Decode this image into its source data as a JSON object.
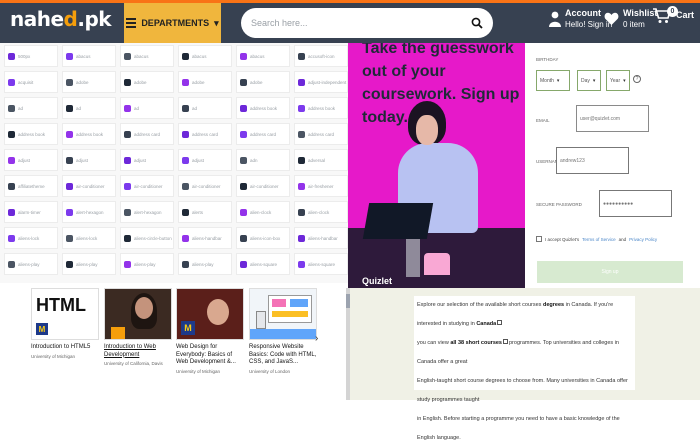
{
  "header": {
    "logo_main": "nahe",
    "logo_accent": "d",
    "logo_suffix": ".pk",
    "departments_label": "DEPARTMENTS",
    "search_placeholder": "Search here...",
    "account_title": "Account",
    "account_sub": "Hello! Sign in",
    "wishlist_title": "Wishlist",
    "wishlist_sub": "0 item",
    "cart_title": "Cart",
    "cart_count": "0"
  },
  "icon_grid": {
    "rows": [
      [
        "500px",
        "abacus",
        "abacus",
        "abacus",
        "abacus",
        "accusoft-icon"
      ],
      [
        "acquisit",
        "adobe",
        "adobe",
        "adobe",
        "adobe",
        "adjust-independent"
      ],
      [
        "ad",
        "ad",
        "ad",
        "ad",
        "address book",
        "address book"
      ],
      [
        "address book",
        "address book",
        "address card",
        "address card",
        "address card",
        "address card"
      ],
      [
        "adjust",
        "adjust",
        "adjust",
        "adjust",
        "adn",
        "adversal"
      ],
      [
        "affiliatetheme",
        "air-conditioner",
        "air-conditioner",
        "air-conditioner",
        "air-conditioner",
        "air-freshener"
      ],
      [
        "alarm-timer",
        "alert-hexagon",
        "alert-hexagon",
        "alerts",
        "alien-clock",
        "alien-clock"
      ],
      [
        "aliens-lock",
        "aliens-lock",
        "aliens-circle-button",
        "aliens-handbar",
        "aliens-icon-box",
        "aliens-handbar"
      ],
      [
        "aliens-play",
        "aliens-play",
        "aliens-play",
        "aliens-play",
        "aliens-square",
        "aliens-square"
      ]
    ],
    "glyph_colors": [
      "#6d28d9",
      "#7c3aed",
      "#4b5563",
      "#1f2937",
      "#9333ea",
      "#374151"
    ]
  },
  "promo": {
    "headline": "Take the guesswork out of your coursework. Sign up today.",
    "brand": "Quizlet",
    "bg_color": "#e619c9"
  },
  "signup": {
    "birthday_label": "BIRTHDAY",
    "month": "Month",
    "day": "Day",
    "year": "Year",
    "help": "?",
    "email_label": "EMAIL",
    "email_placeholder": "user@quizlet.com",
    "username_label": "USERNAME",
    "username_placeholder": "andrew123",
    "password_label": "SECURE PASSWORD",
    "password_placeholder": "●●●●●●●●●●",
    "agree_prefix": "I accept Quizlet's",
    "terms": "Terms of Service",
    "and": "and",
    "privacy": "Privacy Policy",
    "button": "Sign up",
    "accent_color": "#86a86b"
  },
  "courses": [
    {
      "title": "Introduction to HTML5",
      "provider": "University of Michigan",
      "thumb_text": "HTML",
      "badge": "M"
    },
    {
      "title": "Introduction to Web Development",
      "provider": "University of California, Davis"
    },
    {
      "title": "Web Design for Everybody: Basics of Web Development &...",
      "provider": "University of Michigan",
      "badge": "M"
    },
    {
      "title": "Responsive Website Basics: Code with HTML, CSS, and JavaS...",
      "provider": "University of London"
    }
  ],
  "description": {
    "line1_a": "Explore our selection of the available short courses",
    "line1_b": "degrees",
    "line1_c": "in Canada. If you're interested in studying in",
    "line1_d": "Canada",
    "line2_a": "you can view",
    "line2_b": "all 38 short courses",
    "line2_c": "programmes. Top universities and colleges in Canada offer a great",
    "line3": "English-taught short course degrees to choose from. Many universities in Canada offer study programmes taught",
    "line4": "in English. Before starting a programme you need to have a basic knowledge of the English language."
  }
}
